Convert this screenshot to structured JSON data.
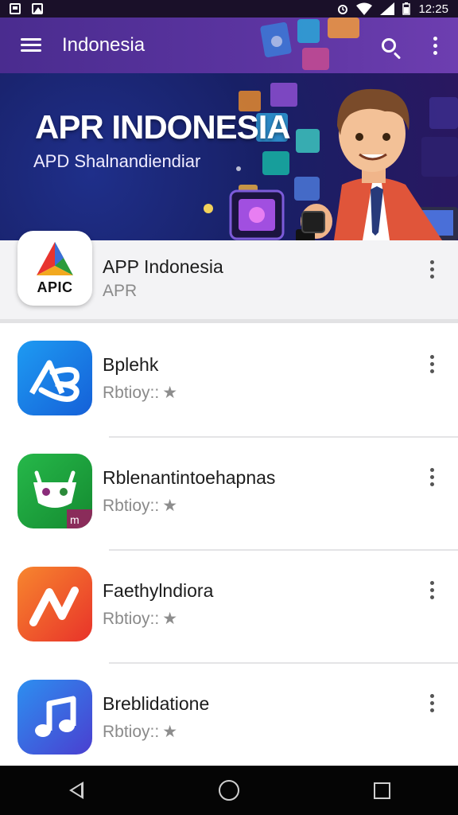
{
  "status_bar": {
    "time": "12:25"
  },
  "app_bar": {
    "title": "Indonesia"
  },
  "banner": {
    "title": "APR INDONESIA",
    "subtitle": "APD Shalnandiendiar"
  },
  "featured": {
    "icon_text": "APIC",
    "title": "APP Indonesia",
    "subtitle": "APR"
  },
  "apps": [
    {
      "title": "Bplehk",
      "subtitle": "Rbtioy::",
      "icon": "ab-app-icon"
    },
    {
      "title": "Rblenantintoehapnas",
      "subtitle": "Rbtioy::",
      "icon": "basket-face-icon"
    },
    {
      "title": "Faethylndiora",
      "subtitle": "Rbtioy::",
      "icon": "n-logo-icon"
    },
    {
      "title": "Breblidatione",
      "subtitle": "Rbtioy::",
      "icon": "music-note-icon"
    }
  ],
  "star_glyph": "★",
  "colors": {
    "app_bar": "#5b34a0",
    "banner": "#182066",
    "icon_blue": "#1976e8",
    "icon_green": "#19a13a",
    "icon_orange": "#f0572a",
    "icon_indigo": "#3b57d6"
  }
}
